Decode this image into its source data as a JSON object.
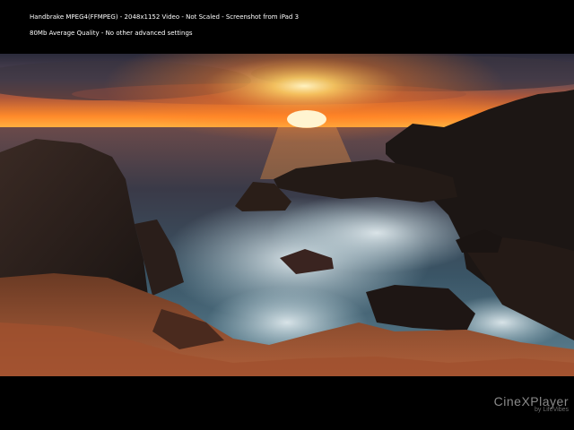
{
  "info": {
    "line1": "Handbrake MPEG4(FFMPEG) - 2048x1152 Video - Not Scaled - Screenshot from iPad 3",
    "line2": "80Mb Average Quality - No other advanced settings"
  },
  "player": {
    "logo_main": "CineXPlayer",
    "logo_sub": "by LifeVibes"
  },
  "colors": {
    "background": "#000000",
    "sun": "#ffd27a",
    "sky_glow": "#ff8a2a",
    "sea": "#3a5566"
  }
}
